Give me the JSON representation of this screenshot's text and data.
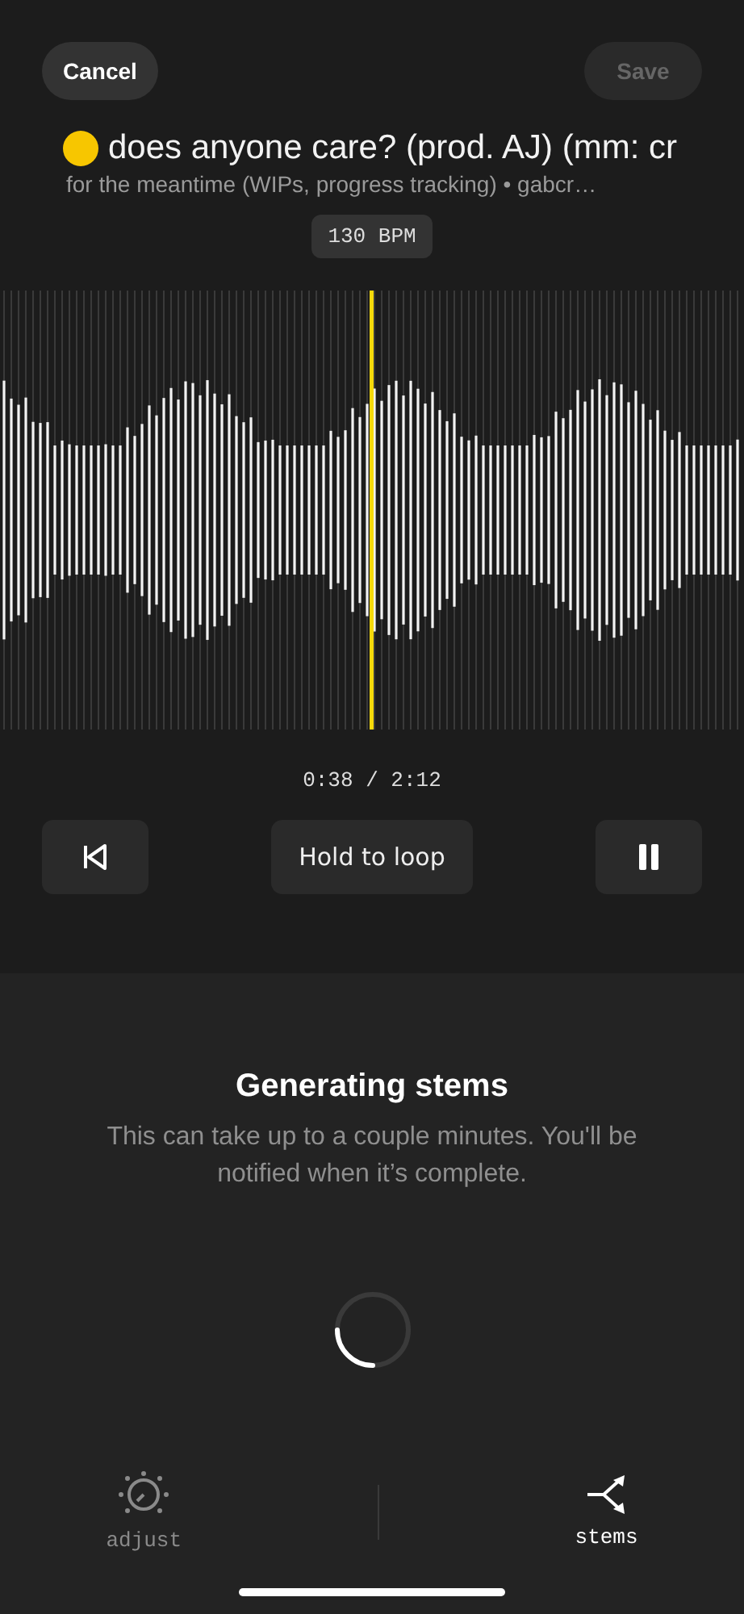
{
  "header": {
    "cancel": "Cancel",
    "save": {
      "label": "Save",
      "disabled": true
    }
  },
  "track": {
    "title": "does anyone care? (prod. AJ) (mm: cr",
    "subtitle": "for the meantime (WIPs, progress tracking) • gabcr…",
    "bpm": "130 BPM"
  },
  "player": {
    "time": "0:38 / 2:12",
    "loop_label": "Hold to loop",
    "playing": true
  },
  "status": {
    "title": "Generating stems",
    "message": "This can take up to a couple minutes. You'll be notified when it’s complete."
  },
  "tabs": [
    {
      "label": "adjust",
      "kind": "adjust",
      "selected": false
    },
    {
      "label": "stems",
      "kind": "stems",
      "selected": true
    }
  ]
}
